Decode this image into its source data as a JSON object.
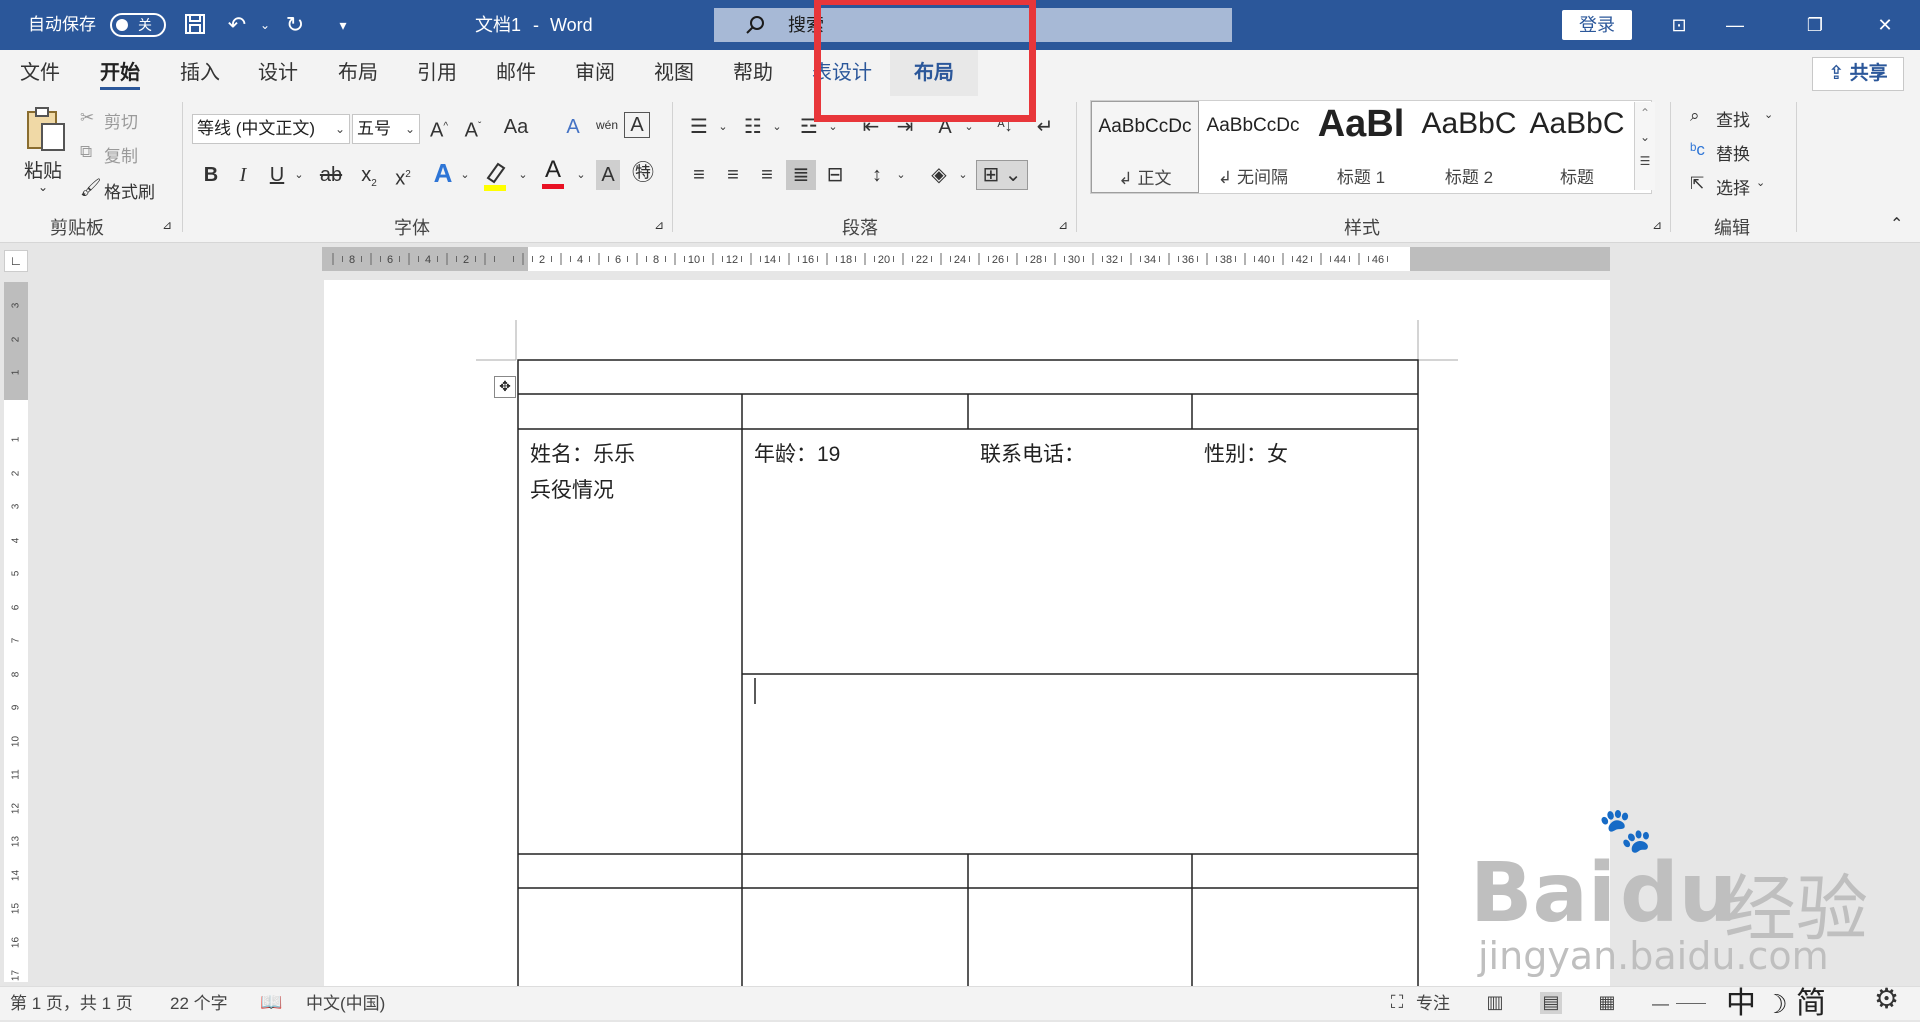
{
  "titlebar": {
    "autosave_label": "自动保存",
    "autosave_state": "关",
    "doc_title": "文档1",
    "dash": "-",
    "app_name": "Word",
    "search_placeholder": "搜索",
    "login_label": "登录"
  },
  "tabs": [
    {
      "label": "文件"
    },
    {
      "label": "开始"
    },
    {
      "label": "插入"
    },
    {
      "label": "设计"
    },
    {
      "label": "布局"
    },
    {
      "label": "引用"
    },
    {
      "label": "邮件"
    },
    {
      "label": "审阅"
    },
    {
      "label": "视图"
    },
    {
      "label": "帮助"
    },
    {
      "label": "表设计"
    },
    {
      "label": "布局"
    }
  ],
  "share_label": "共享",
  "clipboard": {
    "paste": "粘贴",
    "cut": "剪切",
    "copy": "复制",
    "format_painter": "格式刷",
    "group_label": "剪贴板"
  },
  "font": {
    "name": "等线 (中文正文)",
    "size": "五号",
    "grow": "A",
    "shrink": "A",
    "case": "Aa",
    "bold": "B",
    "italic": "I",
    "underline": "U",
    "strike": "ab",
    "sub": "x",
    "sup": "x",
    "group_label": "字体",
    "highlight_color": "#ffff00",
    "font_color": "#e81123"
  },
  "paragraph": {
    "group_label": "段落"
  },
  "styles": {
    "items": [
      {
        "sample": "AaBbCcDc",
        "name": "正文"
      },
      {
        "sample": "AaBbCcDc",
        "name": "无间隔"
      },
      {
        "sample": "AaBl",
        "name": "标题 1"
      },
      {
        "sample": "AaBbC",
        "name": "标题 2"
      },
      {
        "sample": "AaBbC",
        "name": "标题"
      }
    ],
    "group_label": "样式"
  },
  "editing": {
    "find": "查找",
    "replace": "替换",
    "select": "选择",
    "group_label": "编辑"
  },
  "ruler": {
    "ticks": [
      "8",
      "6",
      "4",
      "2",
      "",
      "2",
      "4",
      "6",
      "8",
      "10",
      "12",
      "14",
      "16",
      "18",
      "20",
      "22",
      "24",
      "26",
      "28",
      "30",
      "32",
      "34",
      "36",
      "38",
      "40",
      "42",
      "44",
      "46"
    ]
  },
  "table": {
    "row1": [
      "姓名：乐乐",
      "年龄：19",
      "联系电话：",
      "性别：女"
    ],
    "military": "兵役情况"
  },
  "status": {
    "page": "第 1 页，共 1 页",
    "words": "22 个字",
    "language": "中文(中国)",
    "focus": "专注"
  },
  "ime": {
    "lang": "中",
    "simp": "简"
  },
  "watermark": {
    "brand": "Bai",
    "brand2": "du",
    "cn": "经验",
    "url": "jingyan.baidu.com"
  },
  "colors": {
    "titlebar": "#2b579a",
    "highlight_box": "#e8363a"
  }
}
